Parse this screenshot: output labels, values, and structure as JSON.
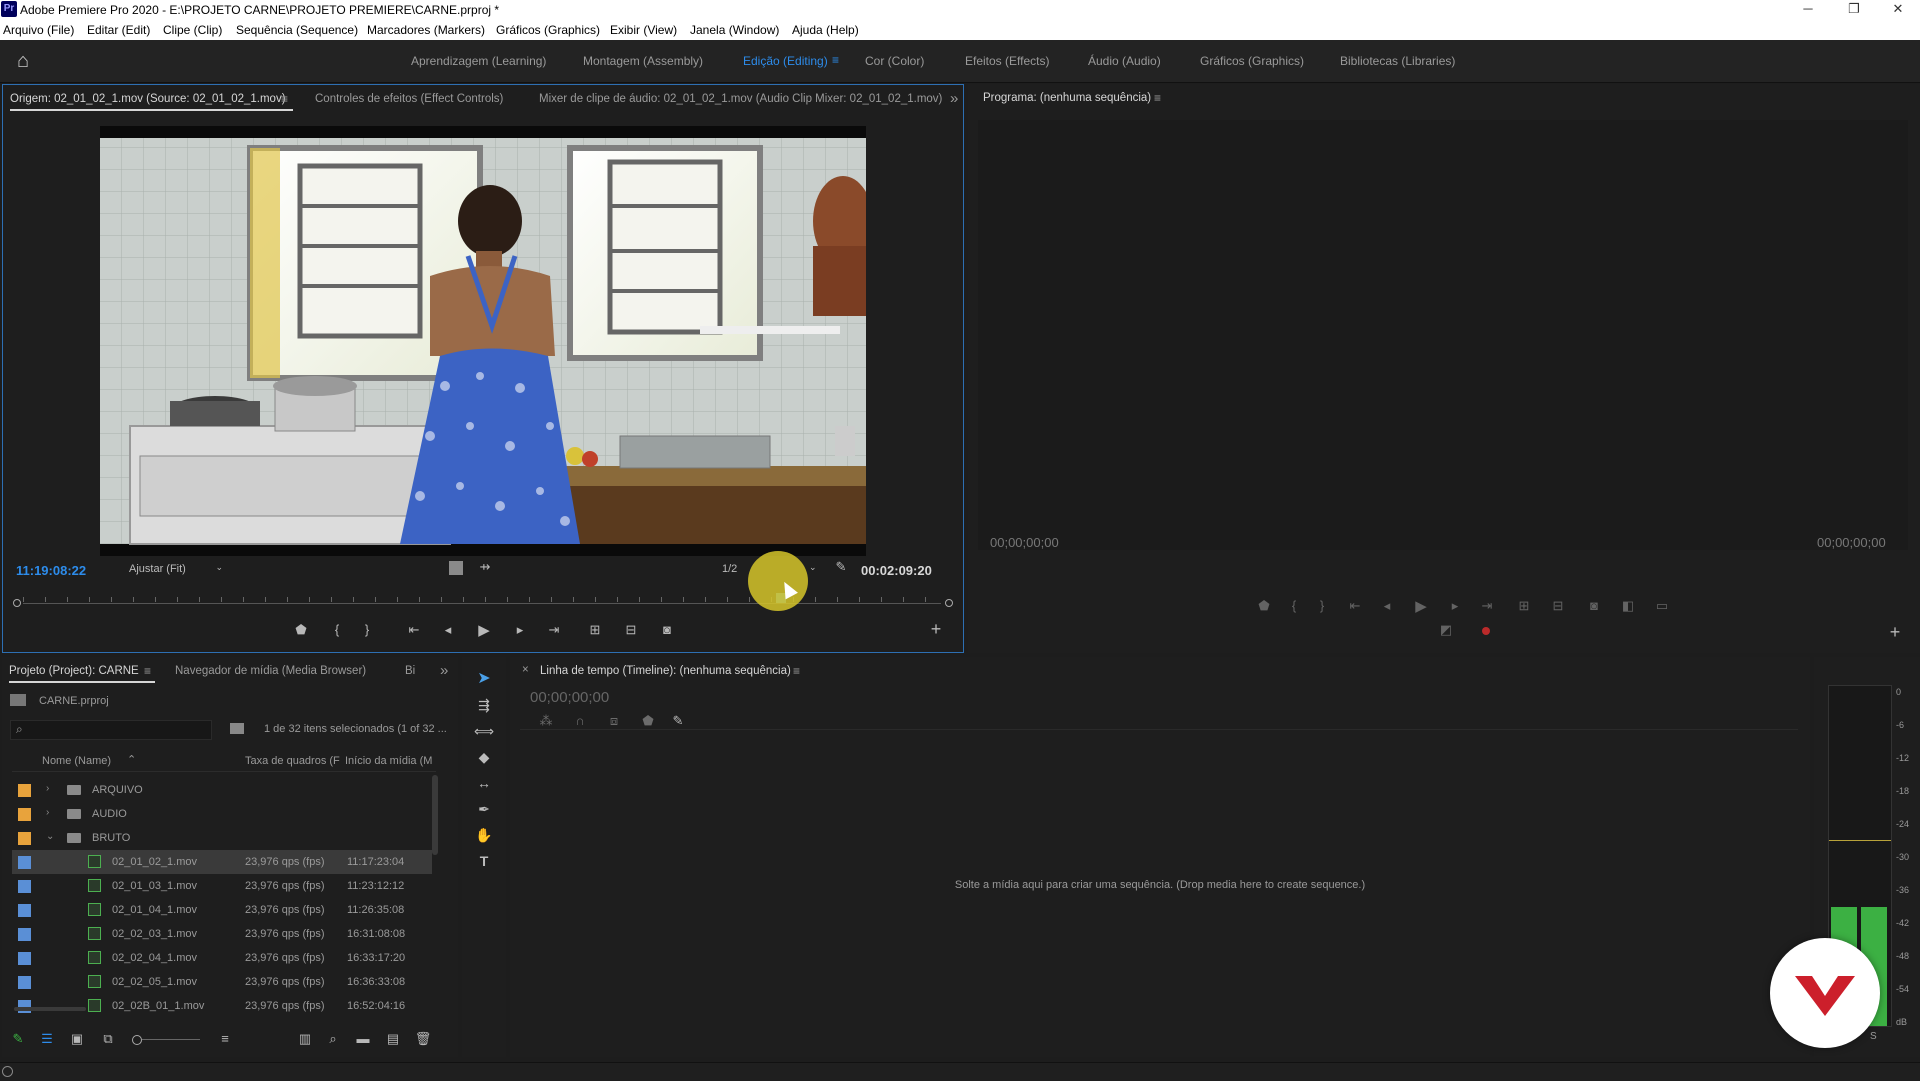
{
  "window": {
    "app_badge": "Pr",
    "title": "Adobe Premiere Pro 2020 - E:\\PROJETO CARNE\\PROJETO PREMIERE\\CARNE.prproj *",
    "minimize": "─",
    "restore": "❐",
    "close": "✕"
  },
  "menu": [
    "Arquivo (File)",
    "Editar (Edit)",
    "Clipe (Clip)",
    "Sequência (Sequence)",
    "Marcadores (Markers)",
    "Gráficos (Graphics)",
    "Exibir (View)",
    "Janela (Window)",
    "Ajuda (Help)"
  ],
  "workspaces": {
    "items": [
      "Aprendizagem (Learning)",
      "Montagem (Assembly)",
      "Edição (Editing)",
      "Cor (Color)",
      "Efeitos (Effects)",
      "Áudio (Audio)",
      "Gráficos (Graphics)",
      "Bibliotecas (Libraries)"
    ],
    "active": "Edição (Editing)"
  },
  "source_panel": {
    "tabs": [
      "Origem: 02_01_02_1.mov (Source: 02_01_02_1.mov)",
      "Controles de efeitos (Effect Controls)",
      "Mixer de clipe de áudio: 02_01_02_1.mov (Audio Clip Mixer: 02_01_02_1.mov)"
    ],
    "timecode": "11:19:08:22",
    "fit": "Ajustar (Fit)",
    "resolution": "1/2",
    "duration": "00:02:09:20",
    "playhead_fraction": 0.82
  },
  "program_panel": {
    "tab": "Programa: (nenhuma sequência)",
    "timecode_left": "00;00;00;00",
    "timecode_right": "00;00;00;00"
  },
  "project_panel": {
    "tabs": [
      "Projeto (Project): CARNE",
      "Navegador de mídia (Media Browser)",
      "Bi"
    ],
    "file": "CARNE.prproj",
    "selection_info": "1 de 32 itens selecionados (1 of 32 ...",
    "columns": [
      "Nome (Name)",
      "Taxa de quadros (F",
      "Início da mídia (M"
    ],
    "rows": [
      {
        "name": "ARQUIVO",
        "fps": "",
        "start": "",
        "type": "folder",
        "color": "#e8a33c",
        "expanded": false
      },
      {
        "name": "AUDIO",
        "fps": "",
        "start": "",
        "type": "folder",
        "color": "#e8a33c",
        "expanded": false
      },
      {
        "name": "BRUTO",
        "fps": "",
        "start": "",
        "type": "folder",
        "color": "#e8a33c",
        "expanded": true
      },
      {
        "name": "02_01_02_1.mov",
        "fps": "23,976 qps (fps)",
        "start": "11:17:23:04",
        "type": "clip",
        "color": "#5a8fd6",
        "selected": true
      },
      {
        "name": "02_01_03_1.mov",
        "fps": "23,976 qps (fps)",
        "start": "11:23:12:12",
        "type": "clip",
        "color": "#5a8fd6"
      },
      {
        "name": "02_01_04_1.mov",
        "fps": "23,976 qps (fps)",
        "start": "11:26:35:08",
        "type": "clip",
        "color": "#5a8fd6"
      },
      {
        "name": "02_02_03_1.mov",
        "fps": "23,976 qps (fps)",
        "start": "16:31:08:08",
        "type": "clip",
        "color": "#5a8fd6"
      },
      {
        "name": "02_02_04_1.mov",
        "fps": "23,976 qps (fps)",
        "start": "16:33:17:20",
        "type": "clip",
        "color": "#5a8fd6"
      },
      {
        "name": "02_02_05_1.mov",
        "fps": "23,976 qps (fps)",
        "start": "16:36:33:08",
        "type": "clip",
        "color": "#5a8fd6"
      },
      {
        "name": "02_02B_01_1.mov",
        "fps": "23,976 qps (fps)",
        "start": "16:52:04:16",
        "type": "clip",
        "color": "#5a8fd6"
      }
    ]
  },
  "timeline_panel": {
    "tab": "Linha de tempo (Timeline): (nenhuma sequência)",
    "timecode": "00;00;00;00",
    "drop_hint": "Solte a mídia aqui para criar uma sequência. (Drop media here to create sequence.)"
  },
  "audio_meter": {
    "scale": [
      "0",
      "-6",
      "-12",
      "-18",
      "-24",
      "-30",
      "-36",
      "-42",
      "-48",
      "-54",
      "dB"
    ],
    "solo": "S",
    "level_fraction": 0.35
  },
  "icons": {
    "home": "⌂",
    "close_tab": "×",
    "more": "»",
    "menu": "≡",
    "plus": "+",
    "search": "⌕",
    "wrench": "🔧"
  },
  "colors": {
    "accent": "#2d8ceb",
    "selection_row": "#3a3a3a",
    "folder_label": "#e8a33c",
    "clip_label": "#5a8fd6",
    "meter_green": "#3cb043",
    "cursor_highlight": "#d6c52a",
    "logo_red": "#cc1f2b"
  }
}
